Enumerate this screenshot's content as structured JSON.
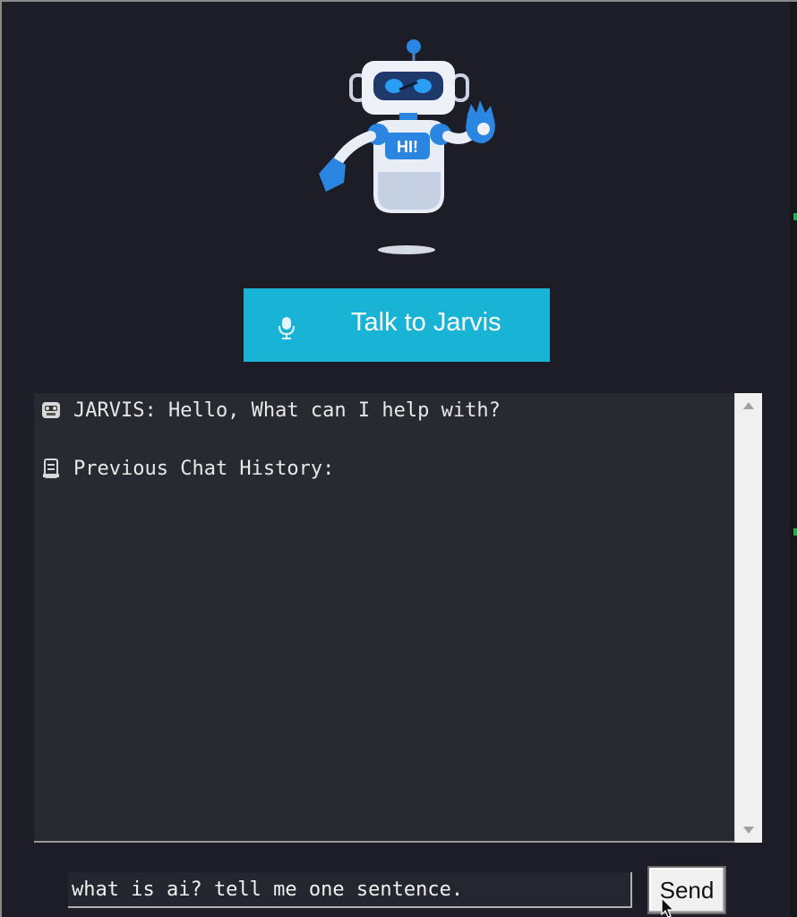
{
  "assistant": {
    "greeting_button": "HI!"
  },
  "talk_button": {
    "label": "Talk to Jarvis",
    "icon": "microphone-icon",
    "color": "#19b3d6"
  },
  "chat": {
    "lines": [
      {
        "icon": "robot-icon",
        "text": "JARVIS: Hello, What can I help with?"
      },
      {
        "icon": "scroll-icon",
        "text": "Previous Chat History:"
      }
    ],
    "background": "#272a31"
  },
  "input": {
    "value": "what is ai? tell me one sentence."
  },
  "send_button": {
    "label": "Send"
  }
}
